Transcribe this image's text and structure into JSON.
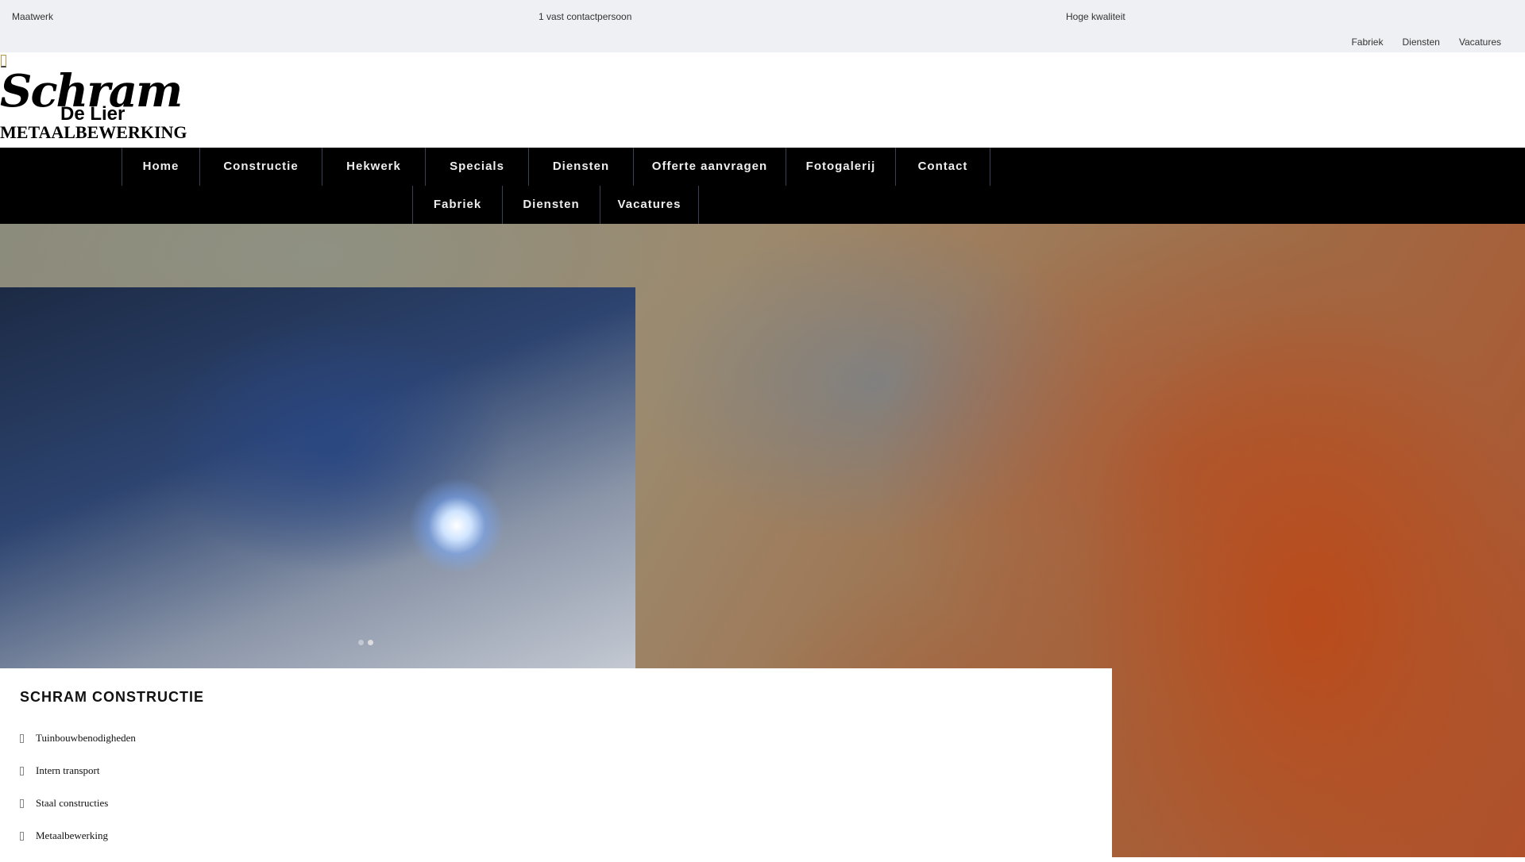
{
  "topbar": {
    "usps": [
      "Maatwerk",
      "1 vast contactpersoon",
      "Hoge kwaliteit"
    ],
    "links": [
      "Fabriek",
      "Diensten",
      "Vacatures"
    ]
  },
  "logo": {
    "name": "Schram",
    "location": "De Lier",
    "tagline": "METAALBEWERKING"
  },
  "nav": {
    "row1": [
      "Home",
      "Constructie",
      "Hekwerk",
      "Specials",
      "Diensten",
      "Offerte aanvragen",
      "Fotogalerij",
      "Contact"
    ],
    "row2": [
      "Fabriek",
      "Diensten",
      "Vacatures"
    ]
  },
  "content": {
    "title": "SCHRAM CONSTRUCTIE",
    "items": [
      "Tuinbouwbenodigheden",
      "Intern transport",
      "Staal constructies",
      "Metaalbewerking"
    ]
  },
  "colors": {
    "nav_bg": "#000000",
    "topbar_bg": "#eff0f4",
    "accent": "#b8964a"
  }
}
